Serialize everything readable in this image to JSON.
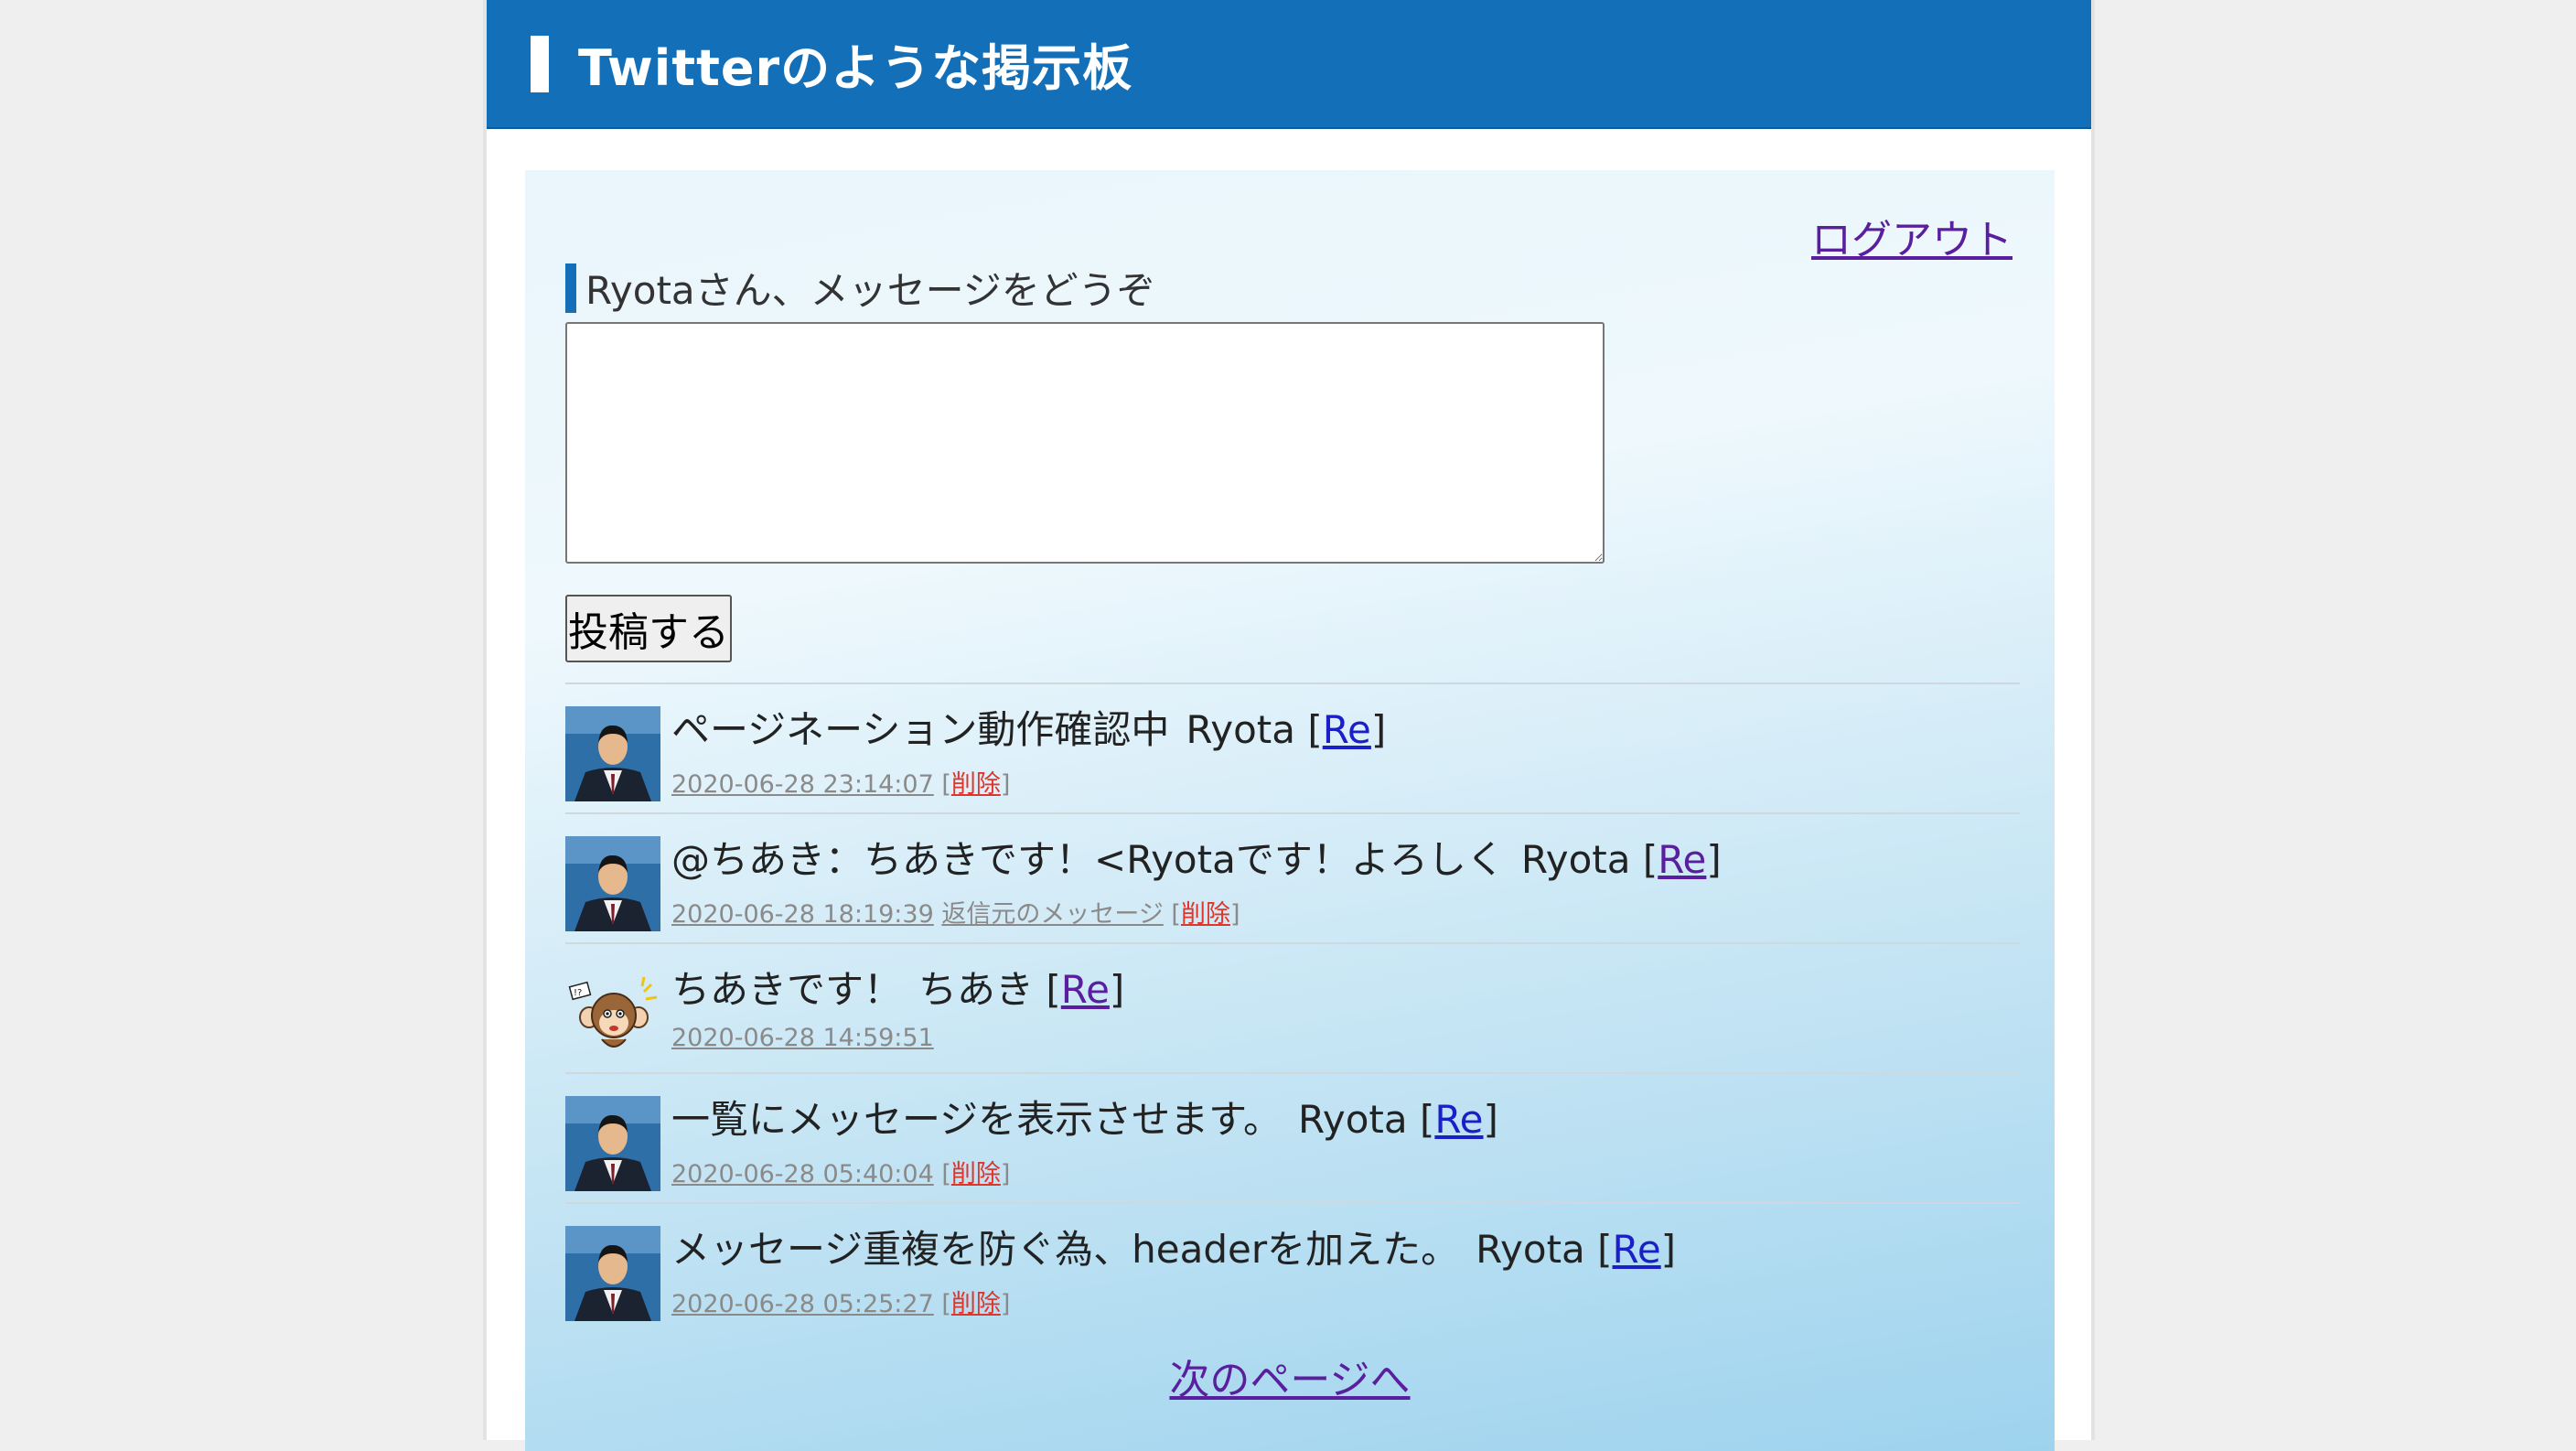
{
  "header": {
    "title": "Twitterのような掲示板"
  },
  "logout_label": "ログアウト",
  "form": {
    "label": "Ryotaさん、メッセージをどうぞ",
    "textarea_value": "",
    "submit_label": "投稿する"
  },
  "posts": [
    {
      "message": "ページネーション動作確認中",
      "author": "Ryota",
      "re_label": "Re",
      "datetime": "2020-06-28 23:14:07",
      "reply_link": "",
      "delete_label": "削除",
      "avatar": "person-photo"
    },
    {
      "message": "@ちあき：ちあきです！<Ryotaです！よろしく",
      "author": "Ryota",
      "re_label": "Re",
      "datetime": "2020-06-28 18:19:39",
      "reply_link": "返信元のメッセージ",
      "delete_label": "削除",
      "avatar": "person-photo"
    },
    {
      "message": "ちあきです！",
      "author": "ちあき",
      "re_label": "Re",
      "datetime": "2020-06-28 14:59:51",
      "reply_link": "",
      "delete_label": "",
      "avatar": "monkey-illustration"
    },
    {
      "message": "一覧にメッセージを表示させます。",
      "author": "Ryota",
      "re_label": "Re",
      "datetime": "2020-06-28 05:40:04",
      "reply_link": "",
      "delete_label": "削除",
      "avatar": "person-photo"
    },
    {
      "message": "メッセージ重複を防ぐ為、headerを加えた。",
      "author": "Ryota",
      "re_label": "Re",
      "datetime": "2020-06-28 05:25:27",
      "reply_link": "",
      "delete_label": "削除",
      "avatar": "person-photo"
    }
  ],
  "next_page_label": "次のページへ",
  "colors": {
    "header": "#126fb8",
    "link": "#1a1fc7",
    "visited": "#5a1f9e",
    "delete": "#e0352b"
  }
}
